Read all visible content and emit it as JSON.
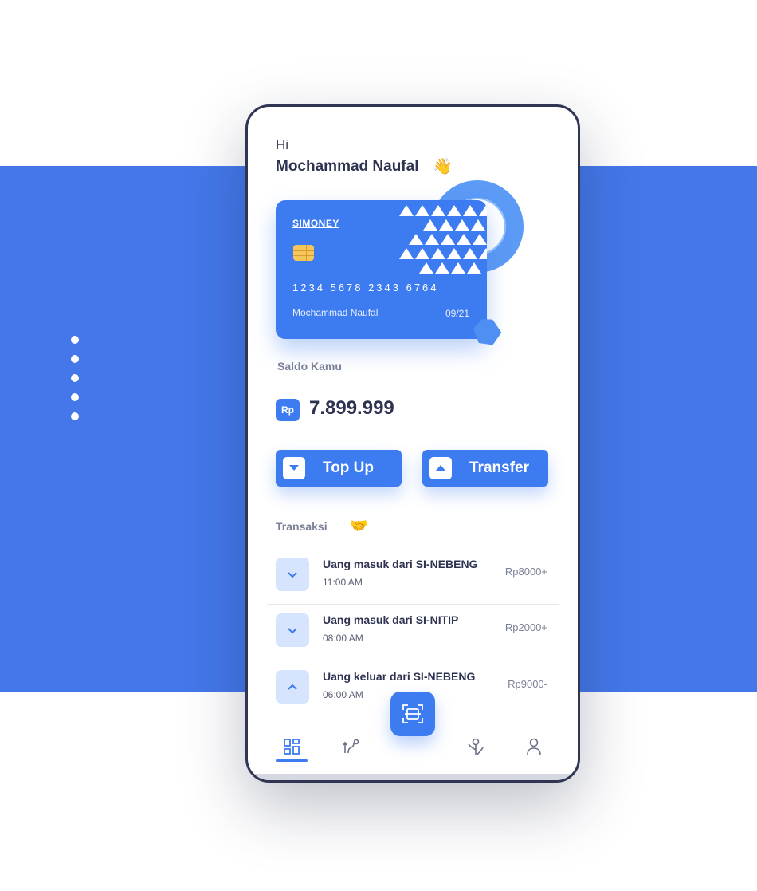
{
  "greeting": {
    "hi": "Hi",
    "name": "Mochammad Naufal",
    "emoji": "👋"
  },
  "card": {
    "brand": "SIMONEY",
    "number": "1234 5678 2343 6764",
    "holder": "Mochammad Naufal",
    "expiry": "09/21"
  },
  "balance": {
    "label": "Saldo Kamu",
    "currency": "Rp",
    "amount": "7.899.999"
  },
  "actions": {
    "top_up": "Top Up",
    "transfer": "Transfer"
  },
  "transactions": {
    "title": "Transaksi",
    "emoji": "🤝",
    "items": [
      {
        "direction": "in",
        "title": "Uang masuk dari SI-NEBENG",
        "time": "11:00 AM",
        "amount": "Rp8000+"
      },
      {
        "direction": "in",
        "title": "Uang masuk dari SI-NITIP",
        "time": "08:00 AM",
        "amount": "Rp2000+"
      },
      {
        "direction": "out",
        "title": "Uang keluar dari SI-NEBENG",
        "time": "06:00 AM",
        "amount": "Rp9000-"
      }
    ]
  },
  "nav": {
    "items": [
      "dashboard-icon",
      "route-icon",
      "scan-icon",
      "tree-icon",
      "profile-icon"
    ],
    "active": "dashboard-icon"
  },
  "colors": {
    "primary": "#3d7bf0",
    "background_band": "#4478ea",
    "text_dark": "#2d3350",
    "text_muted": "#7c8097"
  }
}
